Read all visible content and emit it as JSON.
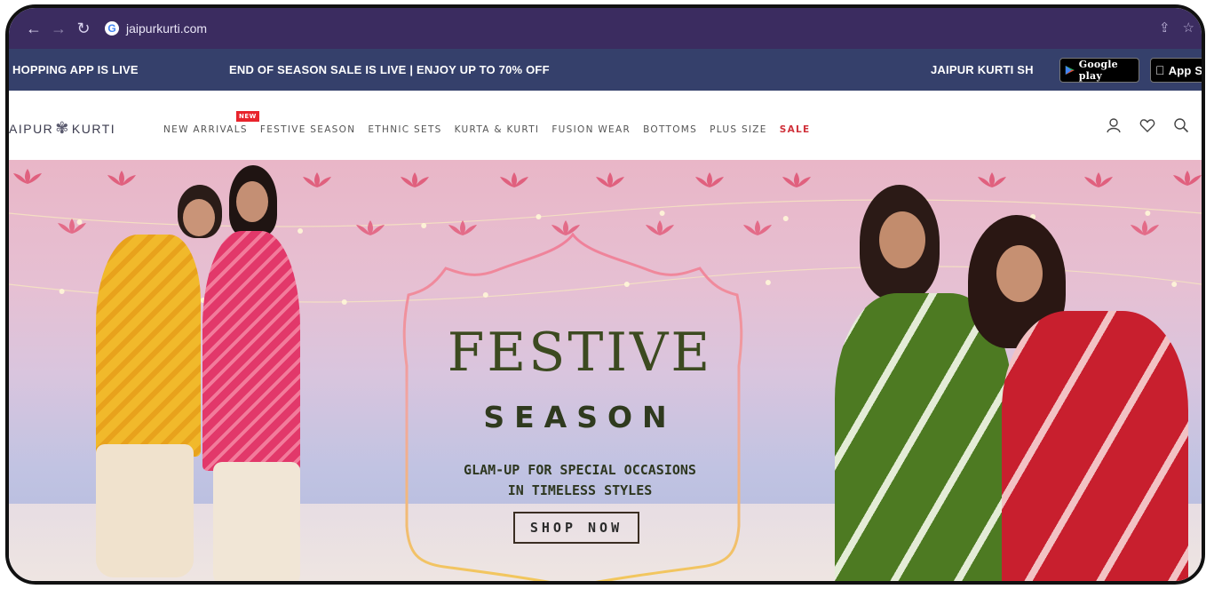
{
  "browser": {
    "url": "jaipurkurti.com",
    "back_icon": "arrow-left-icon",
    "forward_icon": "arrow-right-icon",
    "reload_icon": "reload-icon",
    "share_icon": "share-icon",
    "bookmark_icon": "star-icon"
  },
  "announcement": {
    "left_text": "HOPPING APP IS LIVE",
    "center_text": "END OF SEASON SALE IS LIVE | ENJOY UP TO 70% OFF",
    "right_text": "JAIPUR KURTI SH",
    "google_play_label": "Google play",
    "app_store_label": "App St"
  },
  "header": {
    "logo_left": "AIPUR",
    "logo_right": "KURTI",
    "new_badge": "NEW",
    "menu": [
      {
        "label": "NEW ARRIVALS"
      },
      {
        "label": "FESTIVE SEASON"
      },
      {
        "label": "ETHNIC SETS"
      },
      {
        "label": "KURTA & KURTI"
      },
      {
        "label": "FUSION WEAR"
      },
      {
        "label": "BOTTOMS"
      },
      {
        "label": "PLUS SIZE"
      },
      {
        "label": "SALE"
      }
    ]
  },
  "hero": {
    "title": "FESTIVE",
    "subtitle": "SEASON",
    "tagline_line1": "GLAM-UP FOR SPECIAL OCCASIONS",
    "tagline_line2": "IN TIMELESS STYLES",
    "cta": "SHOP NOW"
  },
  "colors": {
    "browser_bar": "#3b2c60",
    "announcement_bar": "#35406b",
    "sale": "#d0323b",
    "hero_title": "#3c4a20"
  }
}
